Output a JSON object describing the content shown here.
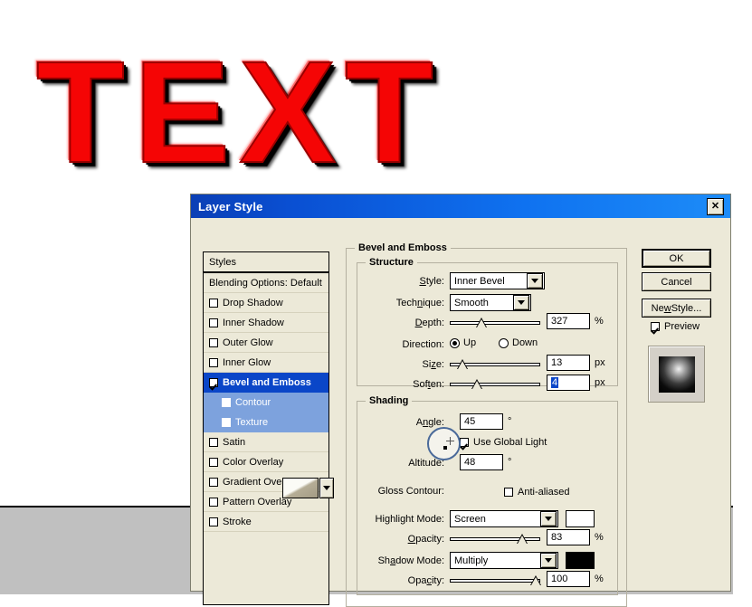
{
  "artwork": {
    "text": "TEXT",
    "color": "#f50505"
  },
  "dialog": {
    "title": "Layer Style",
    "close_label": "✕"
  },
  "styles_list": {
    "header": "Styles",
    "blending_options": "Blending Options: Default",
    "items": [
      {
        "label": "Drop Shadow",
        "checked": false,
        "sub": false,
        "selected": false
      },
      {
        "label": "Inner Shadow",
        "checked": false,
        "sub": false,
        "selected": false
      },
      {
        "label": "Outer Glow",
        "checked": false,
        "sub": false,
        "selected": false
      },
      {
        "label": "Inner Glow",
        "checked": false,
        "sub": false,
        "selected": false
      },
      {
        "label": "Bevel and Emboss",
        "checked": true,
        "sub": false,
        "selected": true
      },
      {
        "label": "Contour",
        "checked": false,
        "sub": true,
        "selected": true
      },
      {
        "label": "Texture",
        "checked": false,
        "sub": true,
        "selected": true
      },
      {
        "label": "Satin",
        "checked": false,
        "sub": false,
        "selected": false
      },
      {
        "label": "Color Overlay",
        "checked": false,
        "sub": false,
        "selected": false
      },
      {
        "label": "Gradient Overlay",
        "checked": false,
        "sub": false,
        "selected": false
      },
      {
        "label": "Pattern Overlay",
        "checked": false,
        "sub": false,
        "selected": false
      },
      {
        "label": "Stroke",
        "checked": false,
        "sub": false,
        "selected": false
      }
    ]
  },
  "panel": {
    "group_title": "Bevel and Emboss",
    "structure": {
      "title": "Structure",
      "style_label": "Style:",
      "style_value": "Inner Bevel",
      "technique_label": "Technique:",
      "technique_value": "Smooth",
      "depth_label": "Depth:",
      "depth_value": "327",
      "depth_unit": "%",
      "depth_pct": 33,
      "direction_label": "Direction:",
      "direction_up": "Up",
      "direction_down": "Down",
      "direction_selected": "Up",
      "size_label": "Size:",
      "size_value": "13",
      "size_unit": "px",
      "size_pct": 9,
      "soften_label": "Soften:",
      "soften_value": "4",
      "soften_unit": "px",
      "soften_pct": 27,
      "soften_selected": true
    },
    "shading": {
      "title": "Shading",
      "angle_label": "Angle:",
      "angle_value": "45",
      "angle_unit": "°",
      "use_global_light": "Use Global Light",
      "use_global_light_checked": true,
      "altitude_label": "Altitude:",
      "altitude_value": "48",
      "altitude_unit": "°",
      "gloss_contour_label": "Gloss Contour:",
      "anti_aliased_label": "Anti-aliased",
      "anti_aliased_checked": false,
      "highlight_mode_label": "Highlight Mode:",
      "highlight_mode_value": "Screen",
      "highlight_color": "#ffffff",
      "highlight_opacity_label": "Opacity:",
      "highlight_opacity_value": "83",
      "highlight_opacity_unit": "%",
      "highlight_opacity_pct": 83,
      "shadow_mode_label": "Shadow Mode:",
      "shadow_mode_value": "Multiply",
      "shadow_color": "#000000",
      "shadow_opacity_label": "Opacity:",
      "shadow_opacity_value": "100",
      "shadow_opacity_unit": "%",
      "shadow_opacity_pct": 100
    }
  },
  "buttons": {
    "ok": "OK",
    "cancel": "Cancel",
    "new_style": "New Style...",
    "preview": "Preview",
    "preview_checked": true
  }
}
